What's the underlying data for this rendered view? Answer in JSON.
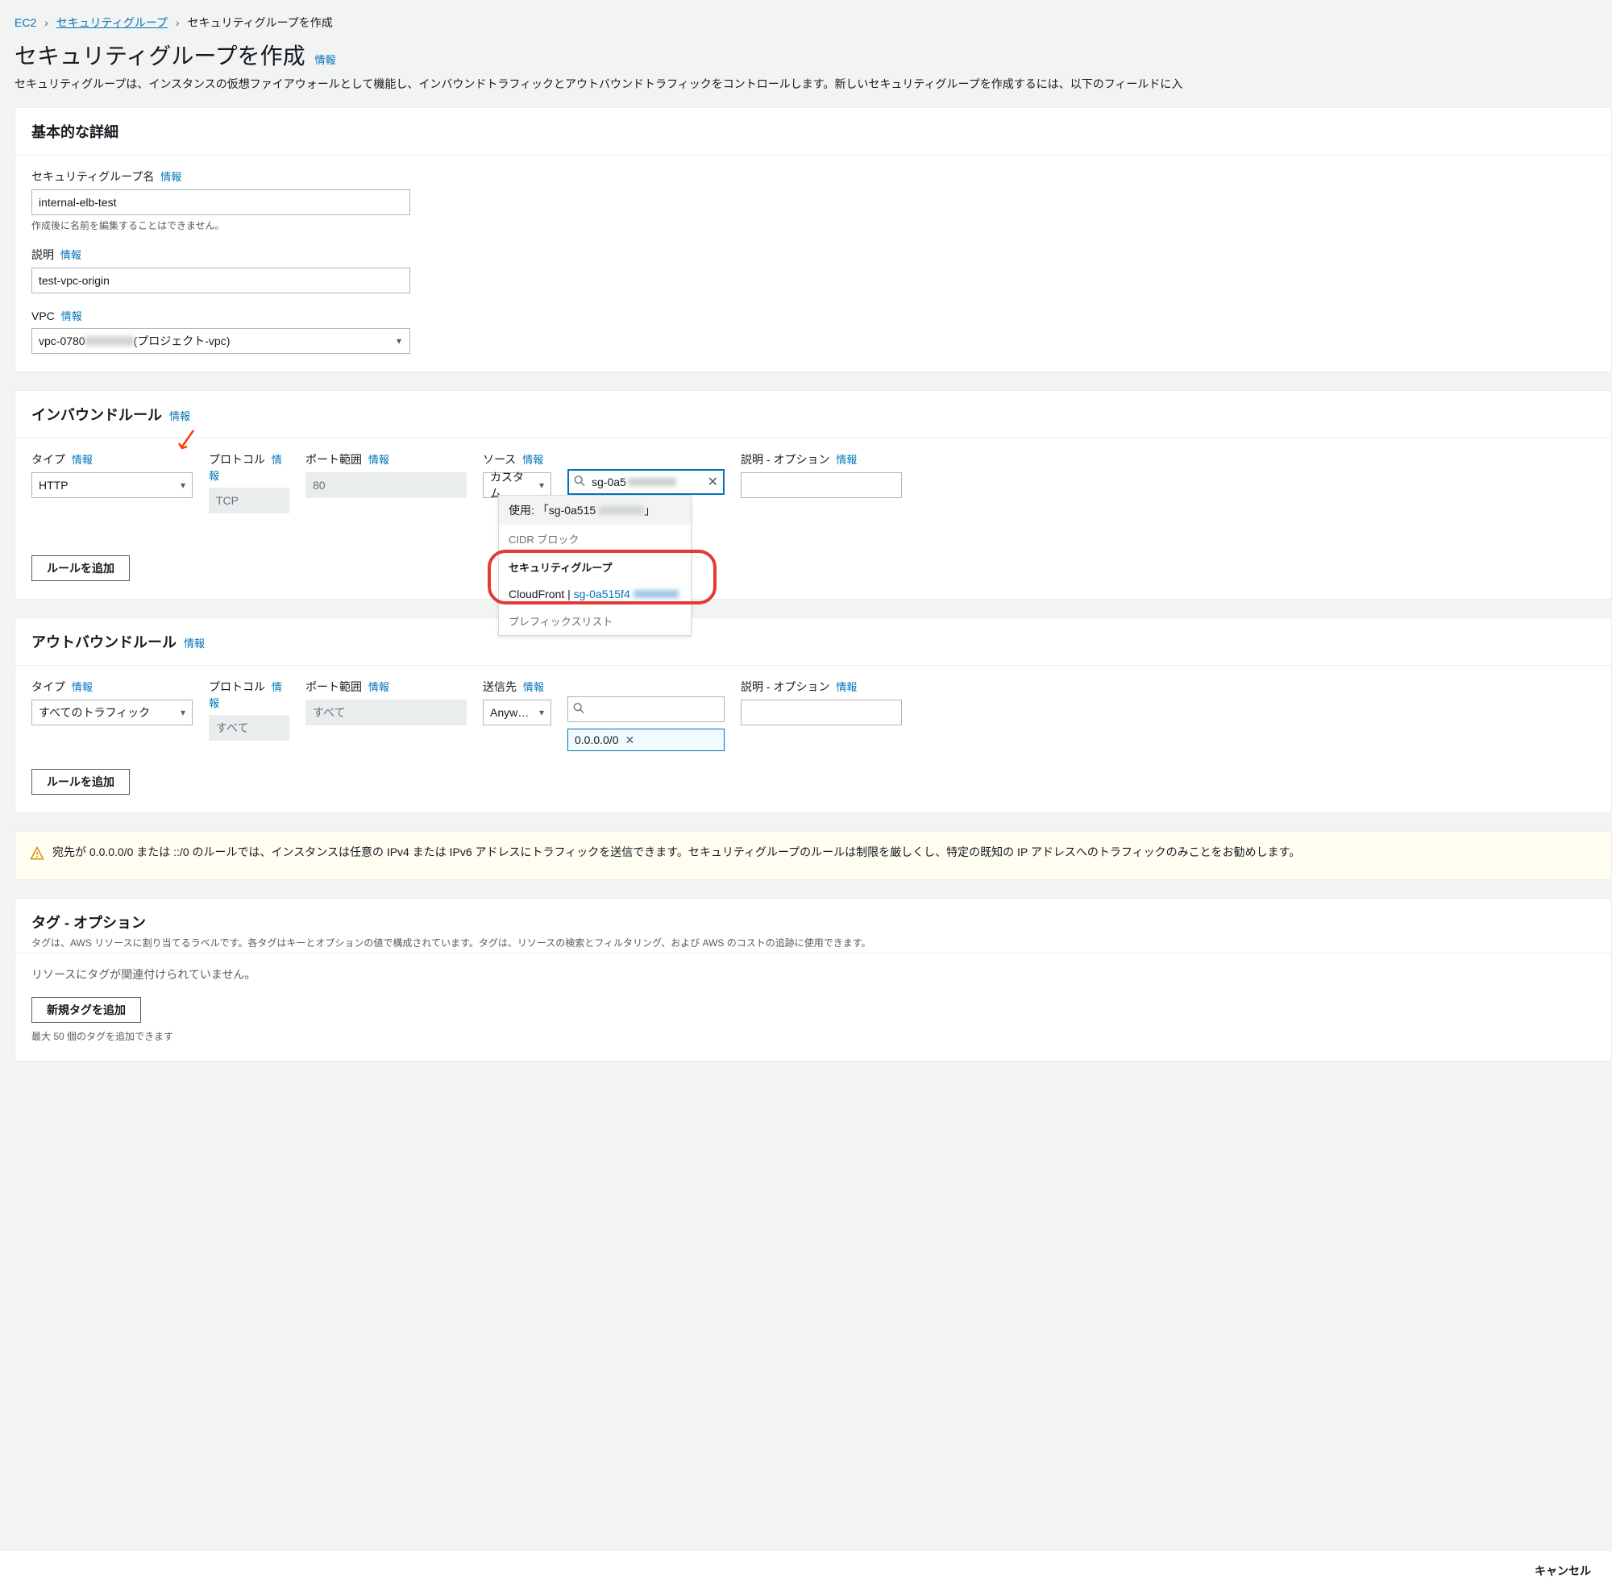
{
  "breadcrumb": {
    "ec2": "EC2",
    "sg": "セキュリティグループ",
    "current": "セキュリティグループを作成"
  },
  "page": {
    "title": "セキュリティグループを作成",
    "info": "情報",
    "description": "セキュリティグループは、インスタンスの仮想ファイアウォールとして機能し、インバウンドトラフィックとアウトバウンドトラフィックをコントロールします。新しいセキュリティグループを作成するには、以下のフィールドに入"
  },
  "basic": {
    "header": "基本的な詳細",
    "name_label": "セキュリティグループ名",
    "name_value": "internal-elb-test",
    "name_help": "作成後に名前を編集することはできません。",
    "desc_label": "説明",
    "desc_value": "test-vpc-origin",
    "vpc_label": "VPC",
    "vpc_prefix": "vpc-0780",
    "vpc_suffix": " (プロジェクト-vpc)"
  },
  "inbound": {
    "header": "インバウンドルール",
    "type_label": "タイプ",
    "protocol_label": "プロトコル",
    "port_label": "ポート範囲",
    "source_label": "ソース",
    "desc_label": "説明 - オプション",
    "type_value": "HTTP",
    "protocol_value": "TCP",
    "port_value": "80",
    "source_value": "カスタム",
    "search_prefix": "sg-0a5",
    "add_rule": "ルールを追加",
    "dd_used": "使用: 「sg-0a515",
    "dd_cidr": "CIDR ブロック",
    "dd_sg": "セキュリティグループ",
    "dd_cf": "CloudFront | ",
    "dd_sgid": "sg-0a515f4",
    "dd_prefix": "プレフィックスリスト"
  },
  "outbound": {
    "header": "アウトバウンドルール",
    "type_label": "タイプ",
    "protocol_label": "プロトコル",
    "port_label": "ポート範囲",
    "dest_label": "送信先",
    "desc_label": "説明 - オプション",
    "type_value": "すべてのトラフィック",
    "protocol_value": "すべて",
    "port_value": "すべて",
    "dest_value": "Anywhere-...",
    "cidr_chip": "0.0.0.0/0",
    "add_rule": "ルールを追加"
  },
  "warning": {
    "text": "宛先が 0.0.0.0/0 または ::/0 のルールでは、インスタンスは任意の IPv4 または IPv6 アドレスにトラフィックを送信できます。セキュリティグループのルールは制限を厳しくし、特定の既知の IP アドレスへのトラフィックのみことをお勧めします。"
  },
  "tags": {
    "header": "タグ - オプション",
    "subtitle": "タグは、AWS リソースに割り当てるラベルです。各タグはキーとオプションの値で構成されています。タグは、リソースの検索とフィルタリング、および AWS のコストの追跡に使用できます。",
    "none": "リソースにタグが関連付けられていません。",
    "add": "新規タグを追加",
    "limit": "最大 50 個のタグを追加できます"
  },
  "footer": {
    "cancel": "キャンセル"
  },
  "icons": {
    "search": "search-icon",
    "clear": "close-icon",
    "chevron": "chevron-right-icon",
    "warn": "warning-icon"
  }
}
